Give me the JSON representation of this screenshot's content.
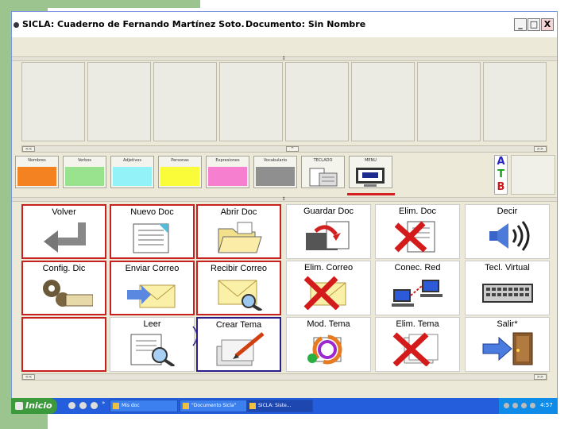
{
  "window": {
    "app_title": "SICLA: Cuaderno de Fernando Martínez Soto.",
    "doc_title": "Documento: Sin Nombre",
    "minimize": "_",
    "maximize": "□",
    "close": "X"
  },
  "scroll": {
    "left": "<<",
    "up": "^",
    "right": ">>"
  },
  "categories": [
    {
      "label": "Nombres",
      "color": "#f58220"
    },
    {
      "label": "Verbos",
      "color": "#9ae38e"
    },
    {
      "label": "Adjetivos",
      "color": "#93f2f8"
    },
    {
      "label": "Personas",
      "color": "#fafc39"
    },
    {
      "label": "Expresiones",
      "color": "#f67fd0"
    },
    {
      "label": "Vocabulario",
      "color": "#8f8f8f"
    },
    {
      "label": "TECLADO",
      "icon": "keyboard-doc-icon"
    },
    {
      "label": "MENU",
      "icon": "menu-monitor-icon"
    }
  ],
  "selected_category": "MENU",
  "atb": {
    "a": "A",
    "t": "T",
    "b": "B"
  },
  "atb_colors": {
    "a": "#2424c8",
    "t": "#18a018",
    "b": "#d01818"
  },
  "grid": [
    {
      "label": "Volver",
      "icon": "return-arrow-icon",
      "frame": "red"
    },
    {
      "label": "Nuevo Doc",
      "icon": "new-document-icon",
      "frame": "red"
    },
    {
      "label": "Abrir Doc",
      "icon": "open-folder-icon",
      "frame": "red"
    },
    {
      "label": "Guardar Doc",
      "icon": "save-document-icon",
      "frame": "none"
    },
    {
      "label": "Elim. Doc",
      "icon": "delete-document-icon",
      "frame": "none"
    },
    {
      "label": "Decir",
      "icon": "speaker-icon",
      "frame": "none"
    },
    {
      "label": "Config. Dic",
      "icon": "gears-icon",
      "frame": "red"
    },
    {
      "label": "Enviar Correo",
      "icon": "send-mail-icon",
      "frame": "red"
    },
    {
      "label": "Recibir Correo",
      "icon": "receive-mail-icon",
      "frame": "red"
    },
    {
      "label": "Elim. Correo",
      "icon": "delete-mail-icon",
      "frame": "none"
    },
    {
      "label": "Conec. Red",
      "icon": "network-icon",
      "frame": "none"
    },
    {
      "label": "Tecl. Virtual",
      "icon": "keyboard-icon",
      "frame": "none"
    },
    {
      "label": "",
      "icon": "",
      "frame": "red"
    },
    {
      "label": "Leer",
      "icon": "read-document-icon",
      "frame": "none"
    },
    {
      "label": "Crear Tema",
      "icon": "create-topic-icon",
      "frame": "blue"
    },
    {
      "label": "Mod. Tema",
      "icon": "modify-topic-icon",
      "frame": "none"
    },
    {
      "label": "Elim. Tema",
      "icon": "delete-topic-icon",
      "frame": "none"
    },
    {
      "label": "Salir*",
      "icon": "exit-door-icon",
      "frame": "none"
    }
  ],
  "taskbar": {
    "start": "Inicio",
    "quicklaunch_more": "»",
    "tasks": [
      {
        "label": "Mis doc",
        "active": false
      },
      {
        "label": "\"Documento Sicla\"",
        "active": false
      },
      {
        "label": "SICLA: Siste...",
        "active": true
      }
    ],
    "clock": "4:57"
  }
}
